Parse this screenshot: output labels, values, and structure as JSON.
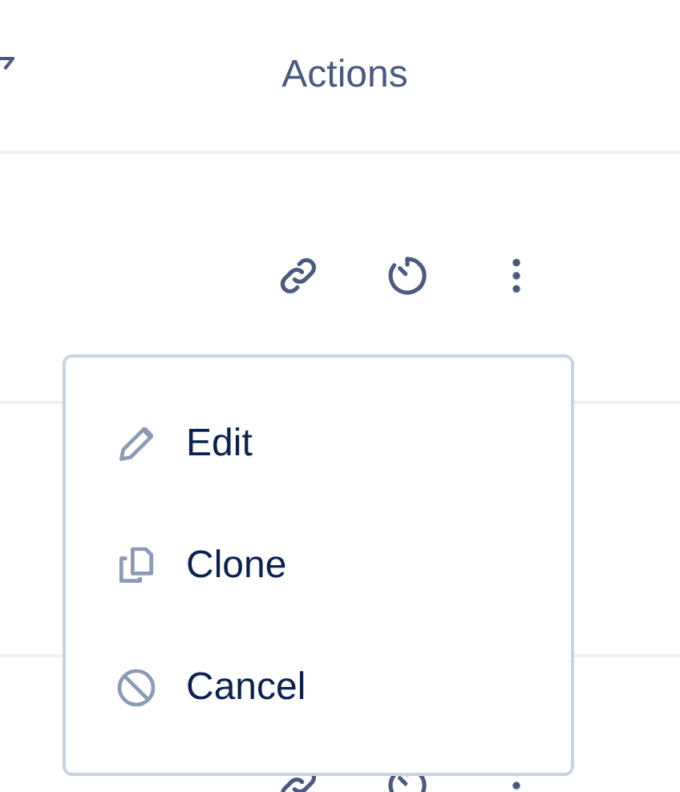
{
  "table": {
    "columns": [
      "Actions"
    ]
  },
  "menu": {
    "items": [
      {
        "kind": "edit",
        "label": "Edit"
      },
      {
        "kind": "clone",
        "label": "Clone"
      },
      {
        "kind": "cancel",
        "label": "Cancel"
      }
    ]
  }
}
